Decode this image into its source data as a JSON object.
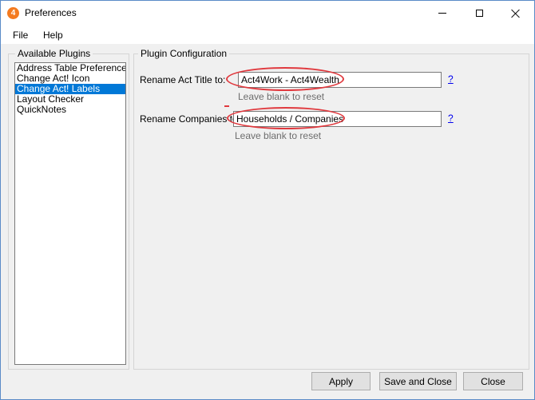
{
  "window": {
    "title": "Preferences",
    "app_icon_glyph": "4",
    "icons": [
      "app-logo-icon",
      "minimize-icon",
      "maximize-icon",
      "close-icon"
    ]
  },
  "menu": {
    "file": "File",
    "help": "Help"
  },
  "plugins": {
    "legend": "Available Plugins",
    "items": [
      {
        "label": "Address Table Preferences",
        "selected": false
      },
      {
        "label": "Change Act! Icon",
        "selected": false
      },
      {
        "label": "Change Act! Labels",
        "selected": true
      },
      {
        "label": "Layout Checker",
        "selected": false
      },
      {
        "label": "QuickNotes",
        "selected": false
      }
    ]
  },
  "config": {
    "legend": "Plugin Configuration",
    "act_title": {
      "label": "Rename Act Title to:",
      "value": "Act4Work - Act4Wealth",
      "hint": "Leave blank to reset",
      "help": "?"
    },
    "companies": {
      "label": "Rename Companies to:",
      "value": "Households / Companies",
      "hint": "Leave blank to reset",
      "help": "?"
    }
  },
  "buttons": {
    "apply": "Apply",
    "save_close": "Save and Close",
    "close": "Close"
  },
  "colors": {
    "selection": "#0078d7",
    "annotation": "#e0393e",
    "app_icon": "#f47b20",
    "link": "#0000ee"
  }
}
